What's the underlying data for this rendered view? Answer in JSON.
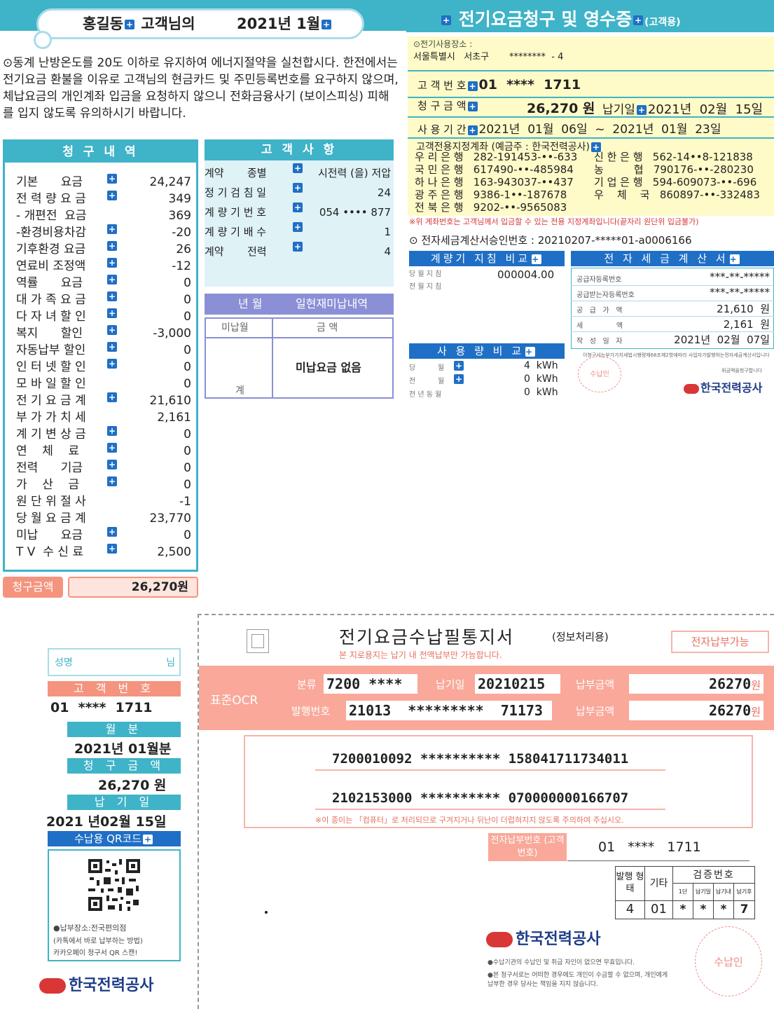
{
  "header": {
    "customer_line": "홍길동",
    "customer_suffix": "고객님의",
    "bill_month": "2021년 1월"
  },
  "notice": "⊙동계 난방온도를 20도 이하로 유지하여 에너지절약을 실천합시다. 한전에서는 전기요금 환불을 이유로 고객님의 현금카드 및 주민등록번호를 요구하지 않으며, 체납요금의 개인계좌 입금을 요청하지 않으니 전화금융사기 (보이스피싱) 피해를 입지 않도록 유의하시기 바랍니다.",
  "billing": {
    "title": "청 구 내 역",
    "rows": [
      {
        "label": "기본      요금",
        "plus": true,
        "value": "24,247"
      },
      {
        "label": "전 력 량 요 금",
        "plus": true,
        "value": "349"
      },
      {
        "label": "- 개편전  요금",
        "plus": false,
        "value": "369"
      },
      {
        "label": "-환경비용차감",
        "plus": true,
        "value": "-20"
      },
      {
        "label": "기후환경 요금",
        "plus": true,
        "value": "26"
      },
      {
        "label": "연료비 조정액",
        "plus": true,
        "value": "-12"
      },
      {
        "label": "역률      요금",
        "plus": true,
        "value": "0"
      },
      {
        "label": "대 가 족 요 금",
        "plus": true,
        "value": "0"
      },
      {
        "label": "다 자 녀 할 인",
        "plus": true,
        "value": "0"
      },
      {
        "label": "복지      할인",
        "plus": true,
        "value": "-3,000"
      },
      {
        "label": "자동납부 할인",
        "plus": true,
        "value": "0"
      },
      {
        "label": "인 터 넷 할 인",
        "plus": true,
        "value": "0"
      },
      {
        "label": "모 바 일 할 인",
        "plus": false,
        "value": "0"
      },
      {
        "label": "전 기 요 금 계",
        "plus": true,
        "value": "21,610"
      },
      {
        "label": "부 가 가 치 세",
        "plus": false,
        "value": "2,161"
      },
      {
        "label": "계 기 변 상 금",
        "plus": true,
        "value": "0"
      },
      {
        "label": "연    체    료",
        "plus": true,
        "value": "0"
      },
      {
        "label": "전력      기금",
        "plus": true,
        "value": "0"
      },
      {
        "label": "가    산    금",
        "plus": true,
        "value": "0"
      },
      {
        "label": "원 단 위 절 사",
        "plus": false,
        "value": "-1"
      },
      {
        "label": "당 월 요 금 계",
        "plus": false,
        "value": "23,770"
      },
      {
        "label": "미납      요금",
        "plus": true,
        "value": "0"
      },
      {
        "label": "T V  수 신 료",
        "plus": true,
        "value": "2,500"
      }
    ],
    "total_label": "청구금액",
    "total_value": "26,270원"
  },
  "customer": {
    "title": "고 객 사 항",
    "rows": [
      {
        "label": "계약       종별",
        "plus": true,
        "value": "시전력 (을) 저압"
      },
      {
        "label": "정 기 검 침 일",
        "plus": true,
        "value": "24"
      },
      {
        "label": "계 량 기 번 호",
        "plus": true,
        "value": "054 •••• 877"
      },
      {
        "label": "계 량 기 배 수",
        "plus": true,
        "value": "1"
      },
      {
        "label": "계약       전력",
        "plus": true,
        "value": "4"
      }
    ]
  },
  "unpaid": {
    "head_year": "년   월",
    "head_title": "일현재미납내역",
    "col_month": "미납월",
    "col_amount": "금 액",
    "none_text": "미납요금 없음",
    "sum_label": "계"
  },
  "receipt": {
    "title": "전기요금청구 및 영수증",
    "title_suffix": "(고객용)",
    "address_label": "⊙전기사용장소 :",
    "address": "서울특별시   서초구       ********  - 4",
    "customer_no_label": "고 객 번 호",
    "customer_no": "01  ****  1711",
    "amount_label": "청 구 금 액",
    "amount": "26,270 원",
    "due_label": "납기일",
    "due_date": "2021년  02월  15일",
    "period_label": "사 용 기 간",
    "period": "2021년  01월  06일  ~  2021년  01월  23일",
    "bank_title": "고객전용지정계좌 (예금주 : 한국전력공사)",
    "banks_left": [
      "우 리 은 행   282-191453-••-633",
      "국 민 은 행   617490-••-485984",
      "하 나 은 행   163-943037-••437",
      "광 주 은 행   9386-1••-187678",
      "전 북 은 행   9202-••-9565083"
    ],
    "banks_right": [
      "신 한 은 행   562-14••8-121838",
      "농         협   790176-••-280230",
      "기 업 은 행   594-609073-••-696",
      "우    체    국   860897-••-332483"
    ],
    "bank_note": "※위 계좌번호는 고객님께서 입금할 수 있는 전용 지정계좌입니다(끝자리 원단위 입금불가)",
    "tax_approval_label": "⊙  전자세금계산서승인번호  :",
    "tax_approval_no": "20210207-*****01-a0006166"
  },
  "meter": {
    "title": "계량기 지침 비교",
    "row1": "당 월 지 침",
    "row2": "전 월 지 침",
    "value": "000004.00"
  },
  "usage": {
    "title": "사 용 량 비 교",
    "rows": [
      {
        "label": "당          월",
        "value": "4  kWh"
      },
      {
        "label": "전          월",
        "value": "0  kWh"
      },
      {
        "label": "전 년 동 월",
        "value": "0  kWh"
      }
    ]
  },
  "tax": {
    "title": "전 자 세 금 계 산 서",
    "rows": [
      {
        "label": "공급자등록번호",
        "value": "***-**-*****"
      },
      {
        "label": "공급받는자등록번호",
        "value": "***-**-*****"
      },
      {
        "label": "공   급   가   액",
        "value": "21,610  원"
      },
      {
        "label": "세               액",
        "value": "2,161  원"
      },
      {
        "label": "작   성   일   자",
        "value": "2021년  02월  07일"
      }
    ],
    "fine1": "이청구서는부가가치세법시행령제68조제2항에따라 사업자가발행하는전자세금계산서입니다",
    "fine2": "위금액을청구합니다",
    "stamp": "수납인",
    "company": "한국전력공사"
  },
  "slip": {
    "title": "전기요금수납필통지서",
    "title_suffix": "(정보처리용)",
    "subtitle": "본 지로용지는 납기 내 전액납부만 가능합니다.",
    "e_pay": "전자납부가능",
    "ocr_label": "표준OCR",
    "class_label": "분류",
    "class_value": "7200  ****",
    "due_label": "납기일",
    "due_value": "20210215",
    "pay_label": "납부금액",
    "pay_value": "26270",
    "won": "원",
    "issue_label": "발행번호",
    "issue_value": "21013  *********  71173",
    "ocr_line1": "7200010092 ********** 158041711734011",
    "ocr_line2": "2102153000 ********** 070000000166707",
    "ocr_note": "※이 종이는 「컴퓨터」로 처리되므로 구겨지거나 뒤난이 더럽혀지지 않도록 주의하여 주십시오.",
    "epay_no_label": "전자납부번호 (고객번호)",
    "epay_no": "01   ****   1711",
    "issue_type_label": "발행 형태",
    "etc_label": "기타",
    "verify_label": "검증번호",
    "verify_cols": [
      "1단",
      "납기일",
      "납기내",
      "납기후"
    ],
    "issue_type_value": "4",
    "etc_value": "01",
    "verify_values": [
      "*",
      "*",
      "*",
      "7"
    ],
    "company": "한국전력공사",
    "notes": [
      "●수납기관의 수납인 및 취급 자인이 없으면 무효입니다.",
      "●본 청구서로는 어떠한 경우에도 개인이 수금할 수 없으며, 개인에게 납부한 경우 당사는 책임을 지지 않습니다."
    ],
    "stamp": "수납인"
  },
  "stub": {
    "name_label": "성명",
    "name_suffix": "님",
    "cust_no_head": "고 객 번 호",
    "cust_no": "01  ****  1711",
    "month_head": "월   분",
    "month_value": "2021년 01월분",
    "amount_head": "청 구 금 액",
    "amount_value": "26,270 원",
    "due_head": "납  기  일",
    "due_value": "2021 년02월 15일",
    "qr_head": "수납용 QR코드",
    "qr_note1": "●납부장소:전국편의점",
    "qr_note2": "(카톡에서 바로 납부하는 방법)",
    "qr_note3": "카카오페이 청구서 QR 스캔!",
    "company": "한국전력공사"
  },
  "colors": {
    "teal": "#3fb3c8",
    "blue": "#1f6fc6",
    "salmon": "#f9a89a",
    "yellow": "#fffbc8",
    "purple": "#8a8fd6"
  }
}
